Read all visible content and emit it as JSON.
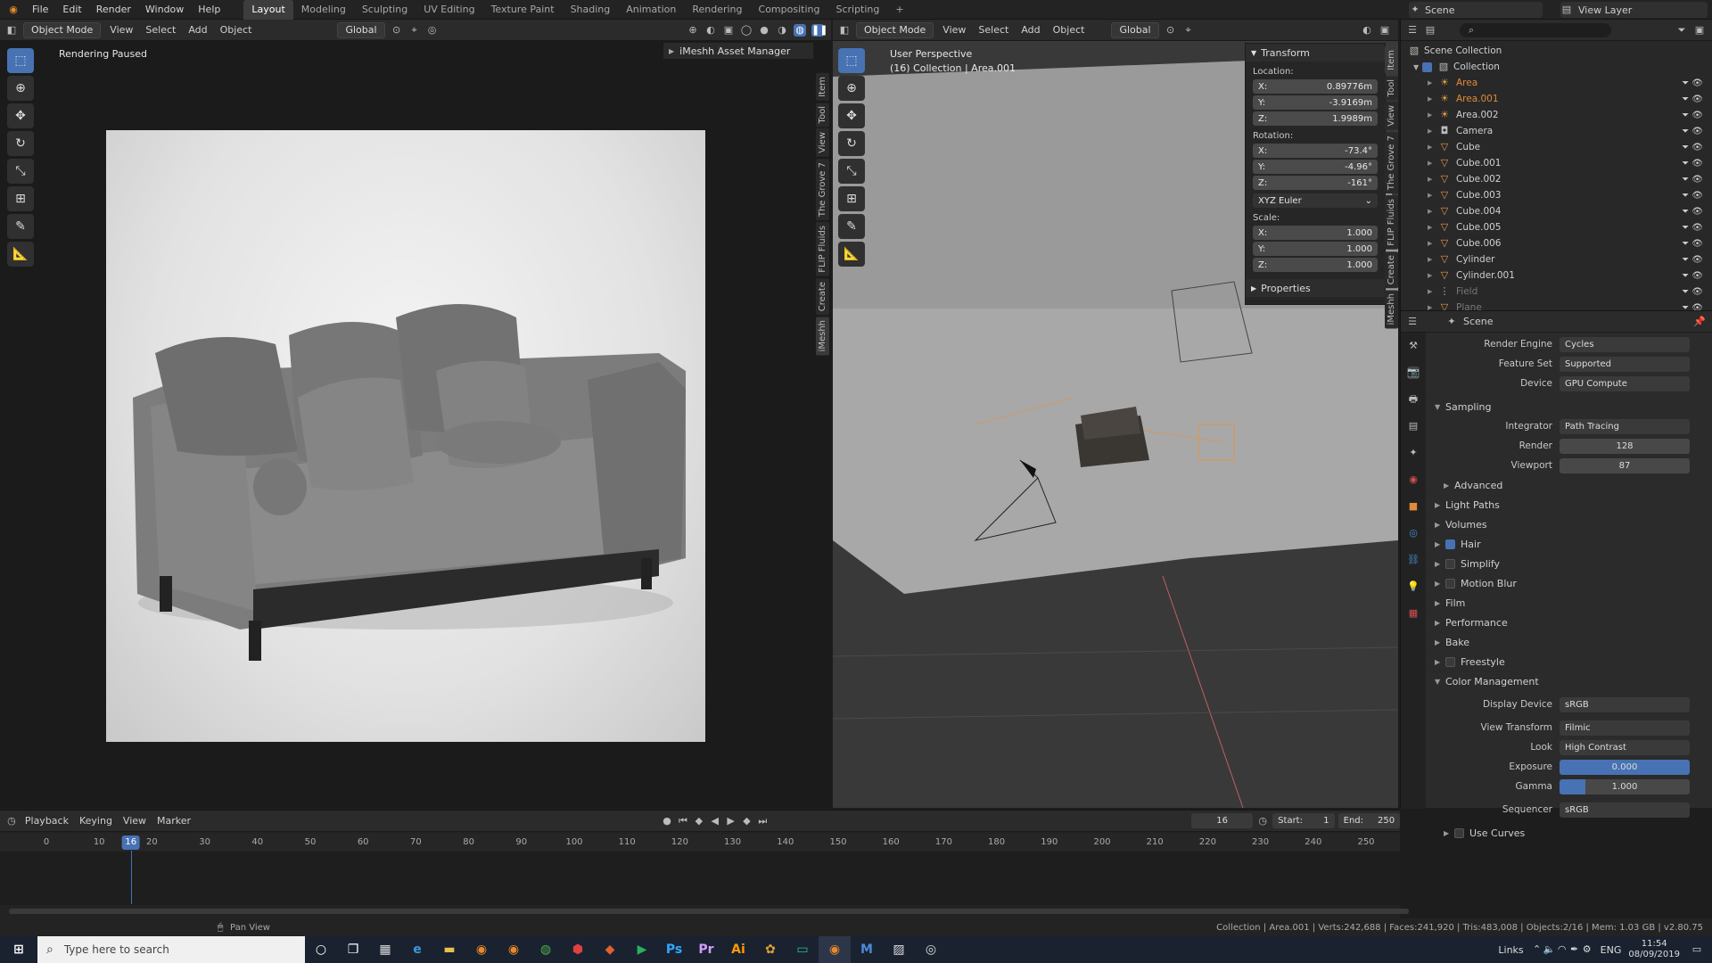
{
  "topbar": {
    "menus": [
      "File",
      "Edit",
      "Render",
      "Window",
      "Help"
    ],
    "workspaces": [
      "Layout",
      "Modeling",
      "Sculpting",
      "UV Editing",
      "Texture Paint",
      "Shading",
      "Animation",
      "Rendering",
      "Compositing",
      "Scripting"
    ],
    "add_tab": "+",
    "scene": "Scene",
    "view_layer": "View Layer"
  },
  "left_view": {
    "mode": "Object Mode",
    "menus": [
      "View",
      "Select",
      "Add",
      "Object"
    ],
    "transform": "Global",
    "status": "Rendering Paused",
    "asset_manager": "iMeshh Asset Manager",
    "side_tabs": [
      "Item",
      "Tool",
      "View",
      "The Grove 7",
      "FLIP Fluids",
      "Create",
      "iMeshh"
    ]
  },
  "right_view": {
    "mode": "Object Mode",
    "menus": [
      "View",
      "Select",
      "Add",
      "Object"
    ],
    "transform": "Global",
    "perspective": "User Perspective",
    "collection": "(16) Collection | Area.001",
    "side_tabs": [
      "Item",
      "Tool",
      "View",
      "The Grove 7",
      "FLIP Fluids",
      "Create",
      "iMeshh"
    ]
  },
  "transform_panel": {
    "title": "Transform",
    "location_label": "Location:",
    "location": [
      {
        "axis": "X:",
        "value": "0.89776m"
      },
      {
        "axis": "Y:",
        "value": "-3.9169m"
      },
      {
        "axis": "Z:",
        "value": "1.9989m"
      }
    ],
    "rotation_label": "Rotation:",
    "rotation": [
      {
        "axis": "X:",
        "value": "-73.4°"
      },
      {
        "axis": "Y:",
        "value": "-4.96°"
      },
      {
        "axis": "Z:",
        "value": "-161°"
      }
    ],
    "rotation_mode": "XYZ Euler",
    "scale_label": "Scale:",
    "scale": [
      {
        "axis": "X:",
        "value": "1.000"
      },
      {
        "axis": "Y:",
        "value": "1.000"
      },
      {
        "axis": "Z:",
        "value": "1.000"
      }
    ],
    "properties": "Properties"
  },
  "outliner": {
    "root": "Scene Collection",
    "collection": "Collection",
    "items": [
      {
        "name": "Area",
        "type": "light",
        "color": "#e08a3a"
      },
      {
        "name": "Area.001",
        "type": "light",
        "color": "#e08a3a"
      },
      {
        "name": "Area.002",
        "type": "light",
        "color": "#d0d0d0"
      },
      {
        "name": "Camera",
        "type": "camera",
        "color": "#d0d0d0"
      },
      {
        "name": "Cube",
        "type": "mesh",
        "color": "#d0d0d0"
      },
      {
        "name": "Cube.001",
        "type": "mesh",
        "color": "#d0d0d0"
      },
      {
        "name": "Cube.002",
        "type": "mesh",
        "color": "#d0d0d0"
      },
      {
        "name": "Cube.003",
        "type": "mesh",
        "color": "#d0d0d0"
      },
      {
        "name": "Cube.004",
        "type": "mesh",
        "color": "#d0d0d0"
      },
      {
        "name": "Cube.005",
        "type": "mesh",
        "color": "#d0d0d0"
      },
      {
        "name": "Cube.006",
        "type": "mesh",
        "color": "#d0d0d0"
      },
      {
        "name": "Cylinder",
        "type": "mesh",
        "color": "#d0d0d0"
      },
      {
        "name": "Cylinder.001",
        "type": "mesh",
        "color": "#d0d0d0"
      },
      {
        "name": "Field",
        "type": "field",
        "color": "#777777"
      },
      {
        "name": "Plane",
        "type": "mesh",
        "color": "#777777"
      }
    ]
  },
  "properties": {
    "scene_name": "Scene",
    "render_engine_label": "Render Engine",
    "render_engine": "Cycles",
    "feature_set_label": "Feature Set",
    "feature_set": "Supported",
    "device_label": "Device",
    "device": "GPU Compute",
    "sampling": "Sampling",
    "integrator_label": "Integrator",
    "integrator": "Path Tracing",
    "render_label": "Render",
    "render_samples": "128",
    "viewport_label": "Viewport",
    "viewport_samples": "87",
    "advanced": "Advanced",
    "sections": [
      "Light Paths",
      "Volumes",
      "Hair",
      "Simplify",
      "Motion Blur",
      "Film",
      "Performance",
      "Bake",
      "Freestyle",
      "Color Management"
    ],
    "display_device_label": "Display Device",
    "display_device": "sRGB",
    "view_transform_label": "View Transform",
    "view_transform": "Filmic",
    "look_label": "Look",
    "look": "High Contrast",
    "exposure_label": "Exposure",
    "exposure": "0.000",
    "gamma_label": "Gamma",
    "gamma": "1.000",
    "sequencer_label": "Sequencer",
    "sequencer": "sRGB",
    "use_curves": "Use Curves"
  },
  "timeline": {
    "menus": [
      "Playback",
      "Keying",
      "View",
      "Marker"
    ],
    "current_frame": "16",
    "start_label": "Start:",
    "start": "1",
    "end_label": "End:",
    "end": "250",
    "ticks": [
      "0",
      "10",
      "20",
      "30",
      "40",
      "50",
      "60",
      "70",
      "80",
      "90",
      "100",
      "110",
      "120",
      "130",
      "140",
      "150",
      "160",
      "170",
      "180",
      "190",
      "200",
      "210",
      "220",
      "230",
      "240",
      "250"
    ],
    "playhead": "16"
  },
  "statusbar": {
    "left": "Pan View",
    "right": "Collection | Area.001 | Verts:242,688 | Faces:241,920 | Tris:483,008 | Objects:2/16 | Mem: 1.03 GB | v2.80.75"
  },
  "taskbar": {
    "search_placeholder": "Type here to search",
    "links": "Links",
    "lang": "ENG",
    "time": "11:54",
    "date": "08/09/2019"
  }
}
